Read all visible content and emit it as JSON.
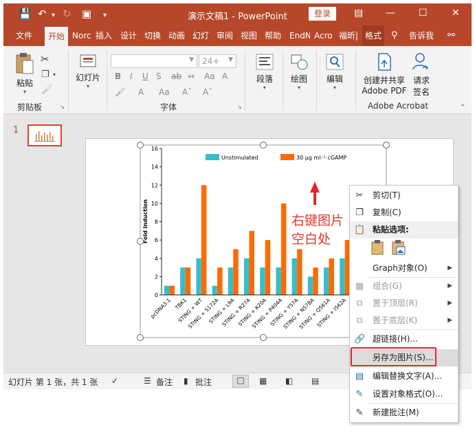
{
  "title_bar": {
    "title": "演示文稿1 - PowerPoint",
    "login_label": "登录"
  },
  "tabs": [
    "文件",
    "开始",
    "Norc",
    "插入",
    "设计",
    "切换",
    "动画",
    "幻灯",
    "审阅",
    "视图",
    "帮助",
    "EndN",
    "Acro",
    "福昕|",
    "格式",
    "告诉我"
  ],
  "ribbon": {
    "paste": "粘贴",
    "clipboard_group": "剪贴板",
    "slides": "幻灯片",
    "font_size": "24+",
    "font_group": "字体",
    "paragraph": "段落",
    "drawing": "绘图",
    "editing": "编辑",
    "create_pdf_1": "创建并共享",
    "create_pdf_2": "Adobe PDF",
    "request_1": "请求",
    "request_2": "签名",
    "acrobat_group": "Adobe Acrobat"
  },
  "thumbnail": {
    "number": "1"
  },
  "chart_data": {
    "type": "bar",
    "ylabel": "Fold induction",
    "ylim": [
      0,
      16
    ],
    "yticks": [
      0,
      2,
      4,
      6,
      8,
      10,
      12,
      14,
      16
    ],
    "categories": [
      "pcDNA3.1",
      "TBK1",
      "STING + WT",
      "STING + S172A",
      "STING + L9A",
      "STING + R27A",
      "STING + K20A",
      "STING + P404A",
      "STING + Y57A",
      "STING + N578A",
      "STING + Q561A",
      "STING + I562A"
    ],
    "series": [
      {
        "name": "Unstimulated",
        "color": "#38bec9",
        "values": [
          1,
          3,
          4,
          1,
          3,
          4,
          3,
          3,
          4,
          2,
          3,
          4
        ]
      },
      {
        "name": "30 μg ml⁻¹ cGAMP",
        "color": "#ff6a00",
        "values": [
          1,
          3,
          12,
          3,
          5,
          7,
          6,
          10,
          5,
          3,
          4,
          6
        ]
      }
    ]
  },
  "annotation": {
    "line1": "右键图片",
    "line2": "空白处"
  },
  "context_menu": [
    {
      "label": "剪切(T)",
      "icon": "scissors-icon"
    },
    {
      "label": "复制(C)",
      "icon": "copy-icon"
    },
    {
      "label": "粘贴选项:",
      "icon": "clipboard-icon"
    },
    {
      "label": "Graph对象(O)",
      "icon": ""
    },
    {
      "label": "组合(G)",
      "icon": "group-icon"
    },
    {
      "label": "置于顶层(R)",
      "icon": "bring-front-icon"
    },
    {
      "label": "置于底层(K)",
      "icon": "send-back-icon"
    },
    {
      "label": "超链接(H)...",
      "icon": "link-icon"
    },
    {
      "label": "另存为图片(S)...",
      "icon": ""
    },
    {
      "label": "编辑替换文字(A)...",
      "icon": "alt-text-icon"
    },
    {
      "label": "设置对象格式(O)...",
      "icon": "format-icon"
    },
    {
      "label": "新建批注(M)",
      "icon": "comment-icon"
    }
  ],
  "status_bar": {
    "slide_info": "幻灯片 第 1 张，共 1 张",
    "notes": "备注",
    "comments": "批注"
  }
}
